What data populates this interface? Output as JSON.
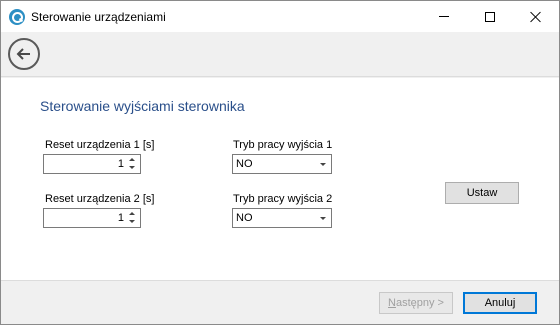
{
  "window": {
    "title": "Sterowanie urządzeniami"
  },
  "section": {
    "title": "Sterowanie wyjściami sterownika"
  },
  "device1": {
    "reset_label": "Reset urządzenia 1 [s]",
    "reset_value": "1",
    "mode_label": "Tryb pracy wyjścia 1",
    "mode_value": "NO"
  },
  "device2": {
    "reset_label": "Reset urządzenia 2 [s]",
    "reset_value": "1",
    "mode_label": "Tryb pracy wyjścia 2",
    "mode_value": "NO"
  },
  "buttons": {
    "set": "Ustaw",
    "next_prefix": "N",
    "next_rest": "astępny >",
    "cancel": "Anuluj"
  },
  "icons": {
    "app": "app-search-icon",
    "back": "back-arrow-icon"
  }
}
